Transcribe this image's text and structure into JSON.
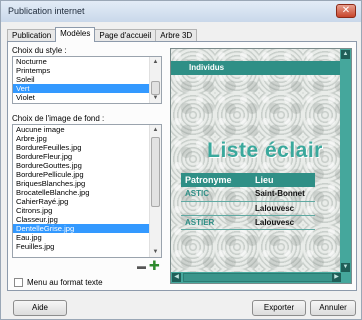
{
  "window": {
    "title": "Publication internet",
    "close_glyph": "✕"
  },
  "tabs": [
    {
      "label": "Publication"
    },
    {
      "label": "Modèles"
    },
    {
      "label": "Page d'accueil"
    },
    {
      "label": "Arbre 3D"
    }
  ],
  "active_tab": "Modèles",
  "style_list": {
    "label": "Choix du style :",
    "items": [
      "Nocturne",
      "Printemps",
      "Soleil",
      "Vert",
      "Violet"
    ],
    "selected": "Vert"
  },
  "background_list": {
    "label": "Choix de l'image de fond :",
    "items": [
      "Aucune image",
      "Arbre.jpg",
      "BordureFeuilles.jpg",
      "BordureFleur.jpg",
      "BordureGouttes.jpg",
      "BordurePellicule.jpg",
      "BriquesBlanches.jpg",
      "BrocatelleBlanche.jpg",
      "CahierRayé.jpg",
      "Citrons.jpg",
      "Classeur.jpg",
      "DentelleGrise.jpg",
      "Eau.jpg",
      "Feuilles.jpg"
    ],
    "selected": "DentelleGrise.jpg"
  },
  "remove_icon_glyph": "▬",
  "add_icon_glyph": "✚",
  "text_menu_checkbox": {
    "label": "Menu au format texte",
    "checked": false
  },
  "preview": {
    "header": "Individus",
    "title": "Liste éclair",
    "table": {
      "headers": [
        "Patronyme",
        "Lieu"
      ],
      "rows": [
        [
          "ASTIC",
          "Saint-Bonnet"
        ],
        [
          "",
          "Lalouvesc"
        ],
        [
          "ASTIER",
          "Lalouvesc"
        ]
      ]
    },
    "colors": {
      "accent": "#2f8f86",
      "title": "#3aa89c",
      "scroll": "#45a79c"
    }
  },
  "footer": {
    "help": "Aide",
    "export": "Exporter",
    "cancel": "Annuler"
  }
}
